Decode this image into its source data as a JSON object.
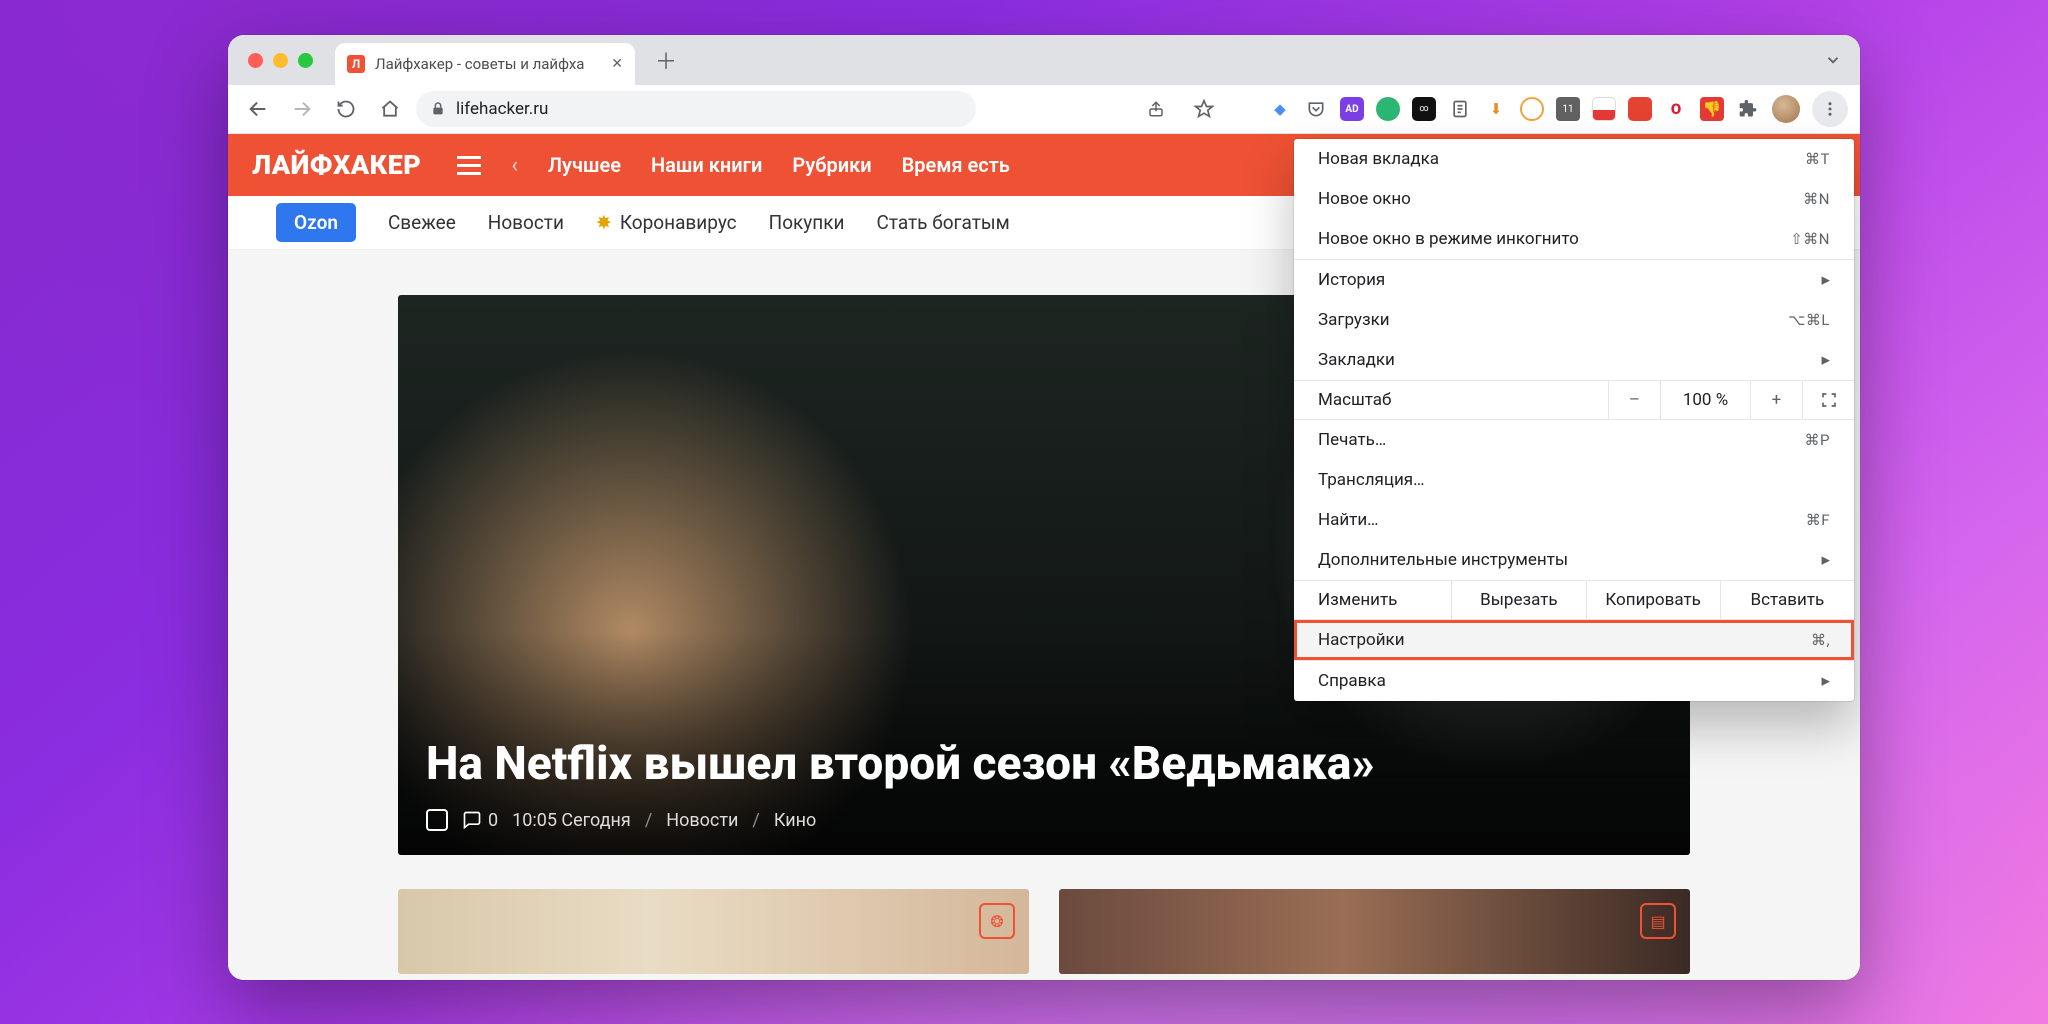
{
  "tab": {
    "title": "Лайфхакер - советы и лайфха",
    "favicon_letter": "Л"
  },
  "toolbar": {
    "url": "lifehacker.ru"
  },
  "extensions": {
    "badge_count": "11"
  },
  "nav": {
    "brand": "ЛАЙФХАКЕР",
    "items": [
      "Лучшее",
      "Наши книги",
      "Рубрики",
      "Время есть"
    ]
  },
  "subnav": {
    "pill": "Ozon",
    "items": [
      "Свежее",
      "Новости",
      "Коронавирус",
      "Покупки",
      "Стать богатым"
    ]
  },
  "hero": {
    "title": "На Netflix вышел второй сезон «Ведьмака»",
    "comments": "0",
    "time": "10:05 Сегодня",
    "cat1": "Новости",
    "cat2": "Кино"
  },
  "menu": {
    "new_tab": {
      "label": "Новая вкладка",
      "kbd": "⌘T"
    },
    "new_window": {
      "label": "Новое окно",
      "kbd": "⌘N"
    },
    "incognito": {
      "label": "Новое окно в режиме инкогнито",
      "kbd": "⇧⌘N"
    },
    "history": {
      "label": "История"
    },
    "downloads": {
      "label": "Загрузки",
      "kbd": "⌥⌘L"
    },
    "bookmarks": {
      "label": "Закладки"
    },
    "zoom": {
      "label": "Масштаб",
      "value": "100 %"
    },
    "print": {
      "label": "Печать…",
      "kbd": "⌘P"
    },
    "cast": {
      "label": "Трансляция…"
    },
    "find": {
      "label": "Найти…",
      "kbd": "⌘F"
    },
    "more_tools": {
      "label": "Дополнительные инструменты"
    },
    "edit": {
      "label": "Изменить",
      "cut": "Вырезать",
      "copy": "Копировать",
      "paste": "Вставить"
    },
    "settings": {
      "label": "Настройки",
      "kbd": "⌘,"
    },
    "help": {
      "label": "Справка"
    }
  }
}
